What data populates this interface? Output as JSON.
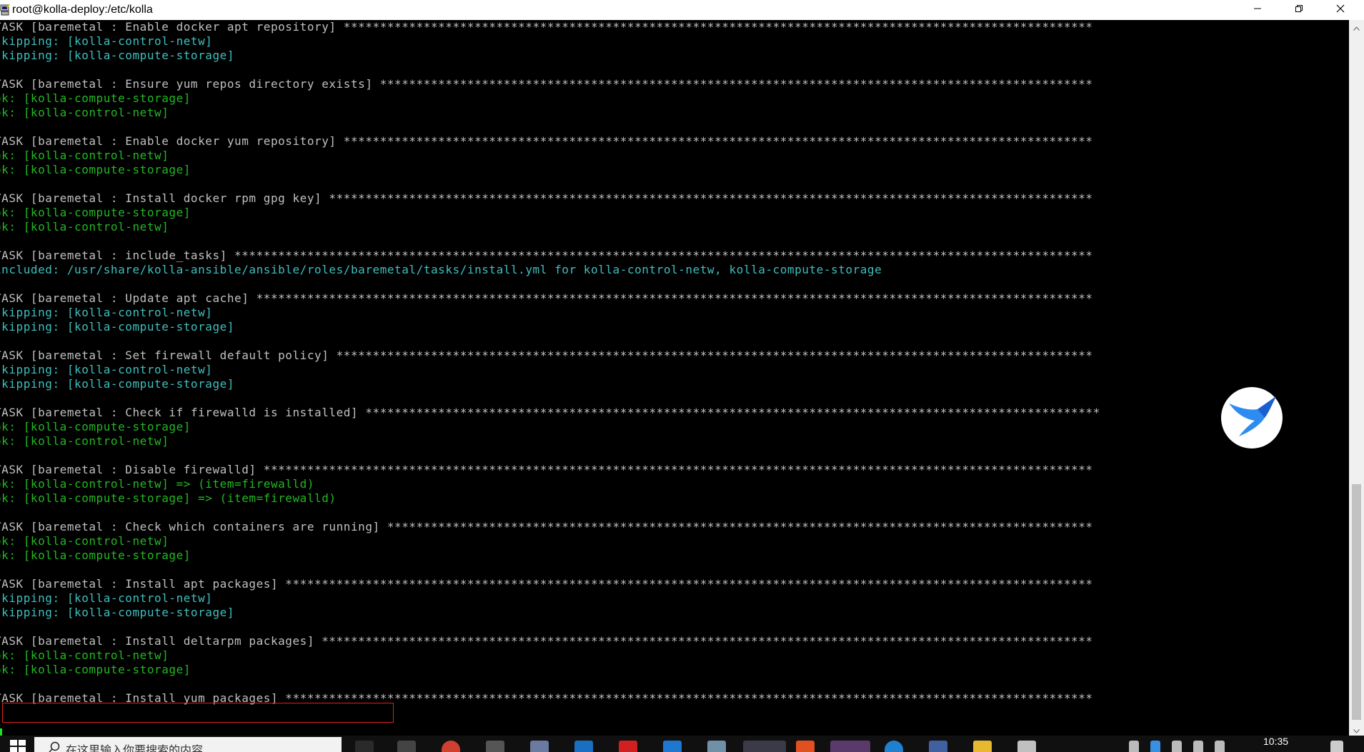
{
  "window": {
    "title": "root@kolla-deploy:/etc/kolla"
  },
  "terminal": {
    "lines": [
      {
        "text": "TASK [baremetal : Enable docker apt repository] *******************************************************************************************************",
        "kind": "task"
      },
      {
        "text": "skipping: [kolla-control-netw]",
        "kind": "skip"
      },
      {
        "text": "skipping: [kolla-compute-storage]",
        "kind": "skip"
      },
      {
        "text": "",
        "kind": "blank"
      },
      {
        "text": "TASK [baremetal : Ensure yum repos directory exists] **************************************************************************************************",
        "kind": "task"
      },
      {
        "text": "ok: [kolla-compute-storage]",
        "kind": "ok"
      },
      {
        "text": "ok: [kolla-control-netw]",
        "kind": "ok"
      },
      {
        "text": "",
        "kind": "blank"
      },
      {
        "text": "TASK [baremetal : Enable docker yum repository] *******************************************************************************************************",
        "kind": "task"
      },
      {
        "text": "ok: [kolla-control-netw]",
        "kind": "ok"
      },
      {
        "text": "ok: [kolla-compute-storage]",
        "kind": "ok"
      },
      {
        "text": "",
        "kind": "blank"
      },
      {
        "text": "TASK [baremetal : Install docker rpm gpg key] *********************************************************************************************************",
        "kind": "task"
      },
      {
        "text": "ok: [kolla-compute-storage]",
        "kind": "ok"
      },
      {
        "text": "ok: [kolla-control-netw]",
        "kind": "ok"
      },
      {
        "text": "",
        "kind": "blank"
      },
      {
        "text": "TASK [baremetal : include_tasks] **********************************************************************************************************************",
        "kind": "task"
      },
      {
        "text": "included: /usr/share/kolla-ansible/ansible/roles/baremetal/tasks/install.yml for kolla-control-netw, kolla-compute-storage",
        "kind": "inc"
      },
      {
        "text": "",
        "kind": "blank"
      },
      {
        "text": "TASK [baremetal : Update apt cache] *******************************************************************************************************************",
        "kind": "task"
      },
      {
        "text": "skipping: [kolla-control-netw]",
        "kind": "skip"
      },
      {
        "text": "skipping: [kolla-compute-storage]",
        "kind": "skip"
      },
      {
        "text": "",
        "kind": "blank"
      },
      {
        "text": "TASK [baremetal : Set firewall default policy] ********************************************************************************************************",
        "kind": "task"
      },
      {
        "text": "skipping: [kolla-control-netw]",
        "kind": "skip"
      },
      {
        "text": "skipping: [kolla-compute-storage]",
        "kind": "skip"
      },
      {
        "text": "",
        "kind": "blank"
      },
      {
        "text": "TASK [baremetal : Check if firewalld is installed] *****************************************************************************************************",
        "kind": "task"
      },
      {
        "text": "ok: [kolla-compute-storage]",
        "kind": "ok"
      },
      {
        "text": "ok: [kolla-control-netw]",
        "kind": "ok"
      },
      {
        "text": "",
        "kind": "blank"
      },
      {
        "text": "TASK [baremetal : Disable firewalld] ******************************************************************************************************************",
        "kind": "task"
      },
      {
        "text": "ok: [kolla-control-netw] => (item=firewalld)",
        "kind": "ok"
      },
      {
        "text": "ok: [kolla-compute-storage] => (item=firewalld)",
        "kind": "ok"
      },
      {
        "text": "",
        "kind": "blank"
      },
      {
        "text": "TASK [baremetal : Check which containers are running] *************************************************************************************************",
        "kind": "task"
      },
      {
        "text": "ok: [kolla-control-netw]",
        "kind": "ok"
      },
      {
        "text": "ok: [kolla-compute-storage]",
        "kind": "ok"
      },
      {
        "text": "",
        "kind": "blank"
      },
      {
        "text": "TASK [baremetal : Install apt packages] ***************************************************************************************************************",
        "kind": "task"
      },
      {
        "text": "skipping: [kolla-control-netw]",
        "kind": "skip"
      },
      {
        "text": "skipping: [kolla-compute-storage]",
        "kind": "skip"
      },
      {
        "text": "",
        "kind": "blank"
      },
      {
        "text": "TASK [baremetal : Install deltarpm packages] **********************************************************************************************************",
        "kind": "task"
      },
      {
        "text": "ok: [kolla-control-netw]",
        "kind": "ok"
      },
      {
        "text": "ok: [kolla-compute-storage]",
        "kind": "ok"
      },
      {
        "text": "",
        "kind": "blank"
      },
      {
        "text": "TASK [baremetal : Install yum packages] ***************************************************************************************************************",
        "kind": "task"
      }
    ]
  },
  "taskbar": {
    "search_placeholder": "在这里输入你要搜索的内容",
    "clock_time": "10:35"
  },
  "colors": {
    "task_text": "#c0c0c0",
    "skipping_text": "#3fbfbf",
    "ok_text": "#22b822",
    "highlight_border": "#e02020"
  },
  "icons": [
    "putty-icon",
    "minimize-icon",
    "maximize-icon",
    "close-icon",
    "bird-float-icon",
    "windows-start-icon",
    "search-icon"
  ]
}
